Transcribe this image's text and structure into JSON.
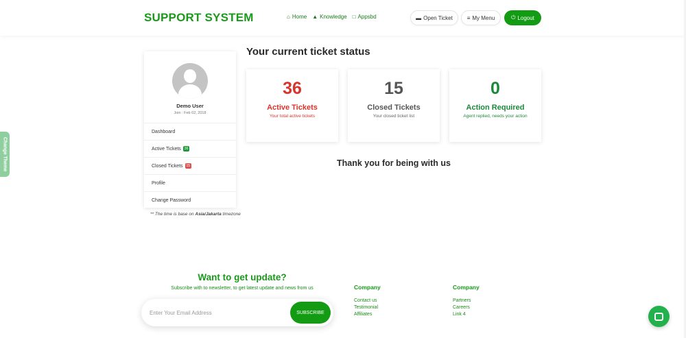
{
  "header": {
    "brand": "SUPPORT SYSTEM",
    "nav": [
      {
        "label": "Home",
        "icon": "home-icon"
      },
      {
        "label": "Knowledge",
        "icon": "graduation-cap-icon"
      },
      {
        "label": "Appsbd",
        "icon": "document-icon"
      }
    ],
    "open_ticket": "Open Ticket",
    "my_menu": "My Menu",
    "logout": "Logout"
  },
  "theme_tab": "Change Theme",
  "profile": {
    "name": "Demo User",
    "join": "Join : Feb 02, 2018",
    "menu": [
      {
        "label": "Dashboard"
      },
      {
        "label": "Active Tickets",
        "badge": "36",
        "badge_color": "#1f9a3a"
      },
      {
        "label": "Closed Tickets",
        "badge": "15",
        "badge_color": "#d9534f"
      },
      {
        "label": "Profile"
      },
      {
        "label": "Change Password"
      }
    ]
  },
  "timezone": {
    "prefix": "** The time is base on",
    "zone": "Asia/Jakarta",
    "suffix": "timezone"
  },
  "status": {
    "title": "Your current ticket status",
    "cards": [
      {
        "number": "36",
        "label": "Active Tickets",
        "sub": "Your total active tickets",
        "color": "#d9342b"
      },
      {
        "number": "15",
        "label": "Closed Tickets",
        "sub": "Your closed ticket list",
        "color": "#555555"
      },
      {
        "number": "0",
        "label": "Action Required",
        "sub": "Agent replied, needs your action",
        "color": "#1a8a3a"
      }
    ]
  },
  "thanks": "Thank you for being with us",
  "newsletter": {
    "title": "Want to get update?",
    "subtitle": "Subscribe with to newsletter, to get latest update and news from us",
    "placeholder": "Enter Your Email Address",
    "button": "SUBSCRIBE"
  },
  "footer": {
    "columns": [
      {
        "heading": "Company",
        "links": [
          "Contact us",
          "Testimonial",
          "Affiliates"
        ]
      },
      {
        "heading": "Company",
        "links": [
          "Partners",
          "Careers",
          "Link 4"
        ]
      }
    ]
  },
  "colors": {
    "brand_green": "#139c13",
    "active_red": "#d9342b"
  }
}
